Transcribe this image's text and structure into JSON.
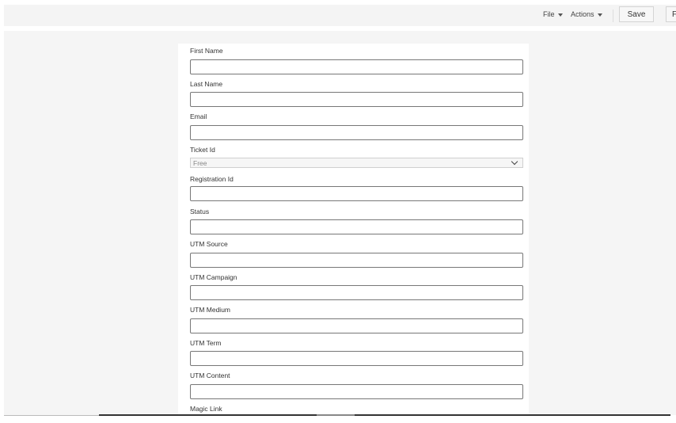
{
  "toolbar": {
    "file_label": "File",
    "actions_label": "Actions",
    "save_label": "Save",
    "cut_button_label": "F"
  },
  "form": {
    "first_name": {
      "label": "First Name",
      "value": ""
    },
    "last_name": {
      "label": "Last Name",
      "value": ""
    },
    "email": {
      "label": "Email",
      "value": ""
    },
    "ticket_id": {
      "label": "Ticket Id",
      "selected": "Free"
    },
    "registration_id": {
      "label": "Registration Id",
      "value": ""
    },
    "status": {
      "label": "Status",
      "value": ""
    },
    "utm_source": {
      "label": "UTM Source",
      "value": ""
    },
    "utm_campaign": {
      "label": "UTM Campaign",
      "value": ""
    },
    "utm_medium": {
      "label": "UTM Medium",
      "value": ""
    },
    "utm_term": {
      "label": "UTM Term",
      "value": ""
    },
    "utm_content": {
      "label": "UTM Content",
      "value": ""
    },
    "magic_link": {
      "label": "Magic Link"
    }
  }
}
